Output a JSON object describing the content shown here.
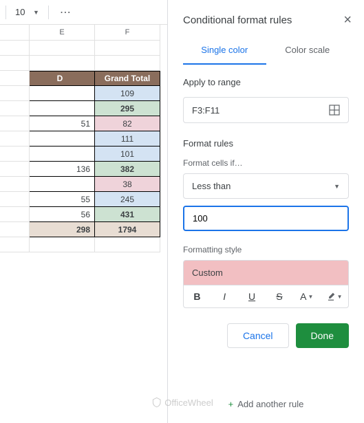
{
  "toolbar": {
    "font_size": "10",
    "more": "⋯"
  },
  "sheet": {
    "col_e": "E",
    "col_f": "F",
    "header_d": "D",
    "header_gt": "Grand Total",
    "rows": [
      {
        "e": "",
        "f": "109",
        "fbg": "bg-blue"
      },
      {
        "e": "",
        "f": "295",
        "fbg": "bg-green",
        "fbold": true
      },
      {
        "e": "51",
        "f": "82",
        "fbg": "bg-pink"
      },
      {
        "e": "",
        "f": "111",
        "fbg": "bg-blue"
      },
      {
        "e": "",
        "f": "101",
        "fbg": "bg-blue"
      },
      {
        "e": "136",
        "f": "382",
        "fbg": "bg-green",
        "fbold": true
      },
      {
        "e": "",
        "f": "38",
        "fbg": "bg-pink"
      },
      {
        "e": "55",
        "f": "245",
        "fbg": "bg-blue"
      },
      {
        "e": "56",
        "f": "431",
        "fbg": "bg-green",
        "fbold": true
      },
      {
        "e": "298",
        "f": "1794",
        "ebg": "bg-tan",
        "fbg": "bg-tan",
        "fbold": true,
        "ebold": true
      }
    ]
  },
  "panel": {
    "title": "Conditional format rules",
    "tab_single": "Single color",
    "tab_scale": "Color scale",
    "apply_label": "Apply to range",
    "range": "F3:F11",
    "rules_label": "Format rules",
    "cells_if_label": "Format cells if…",
    "condition": "Less than",
    "value": "100",
    "style_label": "Formatting style",
    "style_name": "Custom",
    "fmt_b": "B",
    "fmt_i": "I",
    "fmt_u": "U",
    "fmt_s": "S",
    "fmt_a": "A",
    "cancel": "Cancel",
    "done": "Done",
    "add_rule": "Add another rule"
  },
  "watermark": "OfficeWheel"
}
